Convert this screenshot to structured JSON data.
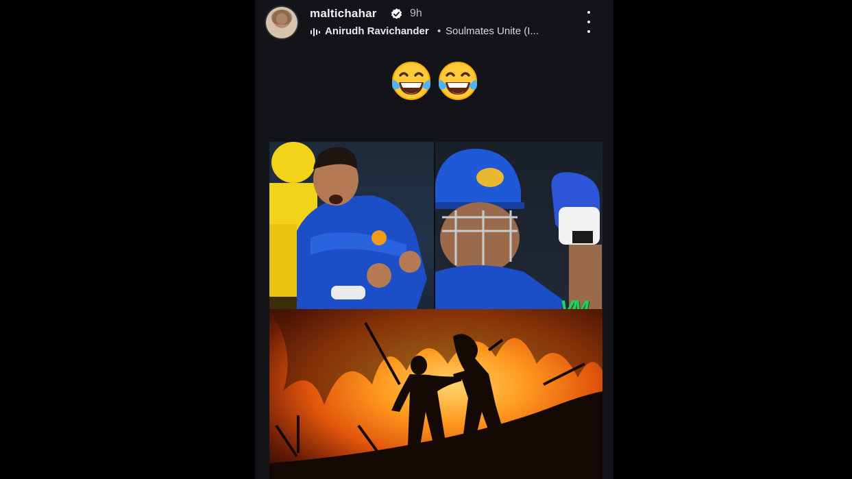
{
  "header": {
    "username": "maltichahar",
    "time_ago": "9h",
    "music": {
      "artist": "Anirudh Ravichander",
      "separator": "•",
      "song": "Soulmates Unite (I..."
    }
  },
  "caption": {
    "emojis": [
      "laughing-tears-emoji",
      "laughing-tears-emoji"
    ]
  },
  "media": {
    "watermark": "VM"
  },
  "colors": {
    "background": "#000000",
    "story_bg": "#121417",
    "verified_blue": "#ffffff",
    "watermark_green": "#1fd25a"
  }
}
